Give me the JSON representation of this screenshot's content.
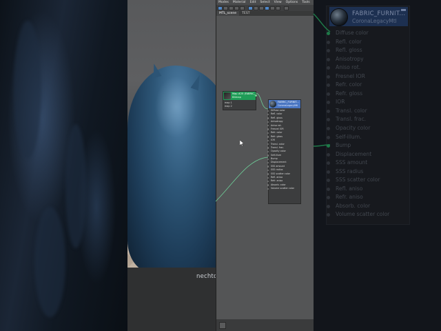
{
  "watermark": "nechto.education",
  "editor": {
    "menu": [
      "Modes",
      "Material",
      "Edit",
      "Select",
      "View",
      "Options",
      "Tools"
    ],
    "tabs": [
      "MTL_scene",
      "TEST"
    ],
    "active_tab": 0
  },
  "map_node": {
    "title": "Map #25 (FABRIC_",
    "type": "Bitmap",
    "slots": [
      "map 1",
      "map 2"
    ]
  },
  "material_node": {
    "title": "FABRIC_FURNIT...",
    "type": "CoronaLegacyMtl",
    "slots": [
      "Diffuse color",
      "Refl. color",
      "Refl. gloss",
      "Anisotropy",
      "Aniso rot.",
      "Fresnel IOR",
      "Refr. color",
      "Refr. gloss",
      "IOR",
      "Transl. color",
      "Transl. frac.",
      "Opacity color",
      "Self-illum",
      "Bump",
      "Displacement",
      "SSS amount",
      "SSS radius",
      "SSS scatter color",
      "Refl. aniso",
      "Refr. aniso",
      "Absorb. color",
      "Volume scatter color"
    ]
  },
  "zoom_node": {
    "title": "FABRIC_FURNIT...",
    "type": "CoronaLegacyMtl",
    "slots": [
      "Diffuse color",
      "Refl. color",
      "Refl. gloss",
      "Anisotropy",
      "Aniso rot.",
      "Fresnel IOR",
      "Refr. color",
      "Refr. gloss",
      "IOR",
      "Transl. color",
      "Transl. frac.",
      "Opacity color",
      "Self-illum.",
      "Bump",
      "Displacement",
      "SSS amount",
      "SSS radius",
      "SSS scatter color",
      "Refl. aniso",
      "Refr. aniso",
      "Absorb. color",
      "Volume scatter color"
    ],
    "connected_slots": [
      "Diffuse color",
      "Bump"
    ]
  },
  "colors": {
    "map_node_header": "#1f9c57",
    "material_node_header": "#4a76c2",
    "wire": "#6fd19a",
    "zoom_header": "#1d3051"
  }
}
